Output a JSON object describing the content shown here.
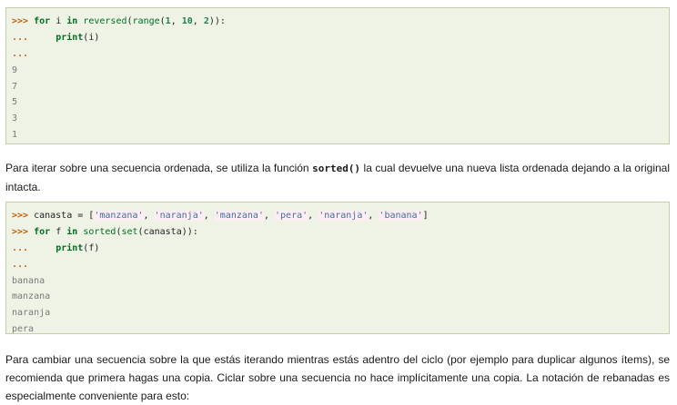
{
  "block1": {
    "line1": {
      "prompt": ">>>",
      "for": "for",
      "var": "i",
      "in": "in",
      "reversed": "reversed",
      "open1": "(",
      "range": "range",
      "open2": "(",
      "a": "1",
      "sep1": ", ",
      "b": "10",
      "sep2": ", ",
      "c": "2",
      "close": ")):"
    },
    "line2": {
      "prompt": "...",
      "indent": "    ",
      "print": "print",
      "args": "(i)"
    },
    "line3": {
      "prompt": "..."
    },
    "outputs": [
      "9",
      "7",
      "5",
      "3",
      "1"
    ]
  },
  "para1": {
    "before": "Para iterar sobre una secuencia ordenada, se utiliza la función ",
    "code": "sorted()",
    "after": " la cual devuelve una nueva lista ordenada dejando a la original intacta."
  },
  "block2": {
    "line1": {
      "prompt": ">>>",
      "text": " canasta = [",
      "s1": "'manzana'",
      "c1": ", ",
      "s2": "'naranja'",
      "c2": ", ",
      "s3": "'manzana'",
      "c3": ", ",
      "s4": "'pera'",
      "c4": ", ",
      "s5": "'naranja'",
      "c5": ", ",
      "s6": "'banana'",
      "end": "]"
    },
    "line2": {
      "prompt": ">>>",
      "for": "for",
      "var": "f",
      "in": "in",
      "sorted": "sorted",
      "open1": "(",
      "set": "set",
      "rest": "(canasta)):"
    },
    "line3": {
      "prompt": "...",
      "indent": "    ",
      "print": "print",
      "args": "(f)"
    },
    "line4": {
      "prompt": "..."
    },
    "outputs": [
      "banana",
      "manzana",
      "naranja",
      "pera"
    ]
  },
  "para2": {
    "text": "Para cambiar una secuencia sobre la que estás iterando mientras estás adentro del ciclo (por ejemplo para duplicar algunos ítems), se recomienda que primera hagas una copia. Ciclar sobre una secuencia no hace implícitamente una copia. La notación de rebanadas es especialmente conveniente para esto:"
  }
}
